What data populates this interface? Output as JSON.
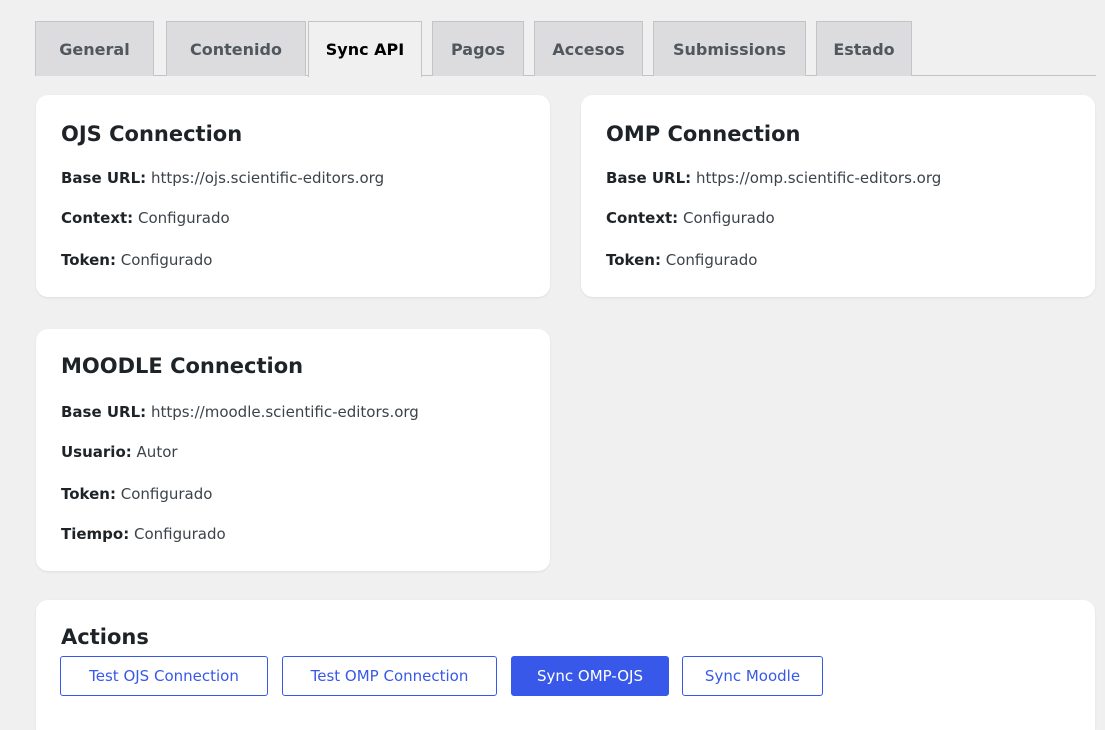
{
  "tabs": [
    {
      "label": "General"
    },
    {
      "label": "Contenido"
    },
    {
      "label": "Sync API",
      "active": true
    },
    {
      "label": "Pagos"
    },
    {
      "label": "Accesos"
    },
    {
      "label": "Submissions"
    },
    {
      "label": "Estado"
    }
  ],
  "ojs": {
    "title": "OJS Connection",
    "base_url_label": "Base URL:",
    "base_url": "https://ojs.scientific-editors.org",
    "context_label": "Context:",
    "context": "Configurado",
    "token_label": "Token:",
    "token": "Configurado"
  },
  "omp": {
    "title": "OMP Connection",
    "base_url_label": "Base URL:",
    "base_url": "https://omp.scientific-editors.org",
    "context_label": "Context:",
    "context": "Configurado",
    "token_label": "Token:",
    "token": "Configurado"
  },
  "moodle": {
    "title": "MOODLE Connection",
    "base_url_label": "Base URL:",
    "base_url": "https://moodle.scientific-editors.org",
    "user_label": "Usuario:",
    "user": "Autor",
    "token_label": "Token:",
    "token": "Configurado",
    "time_label": "Tiempo:",
    "time": "Configurado"
  },
  "actions": {
    "title": "Actions",
    "buttons": [
      {
        "label": "Test OJS Connection"
      },
      {
        "label": "Test OMP Connection"
      },
      {
        "label": "Sync OMP-OJS",
        "primary": true
      },
      {
        "label": "Sync Moodle"
      }
    ]
  },
  "colors": {
    "accent": "#3858e9",
    "background": "#f0f0f1",
    "tab_inactive": "#dcdcde"
  }
}
